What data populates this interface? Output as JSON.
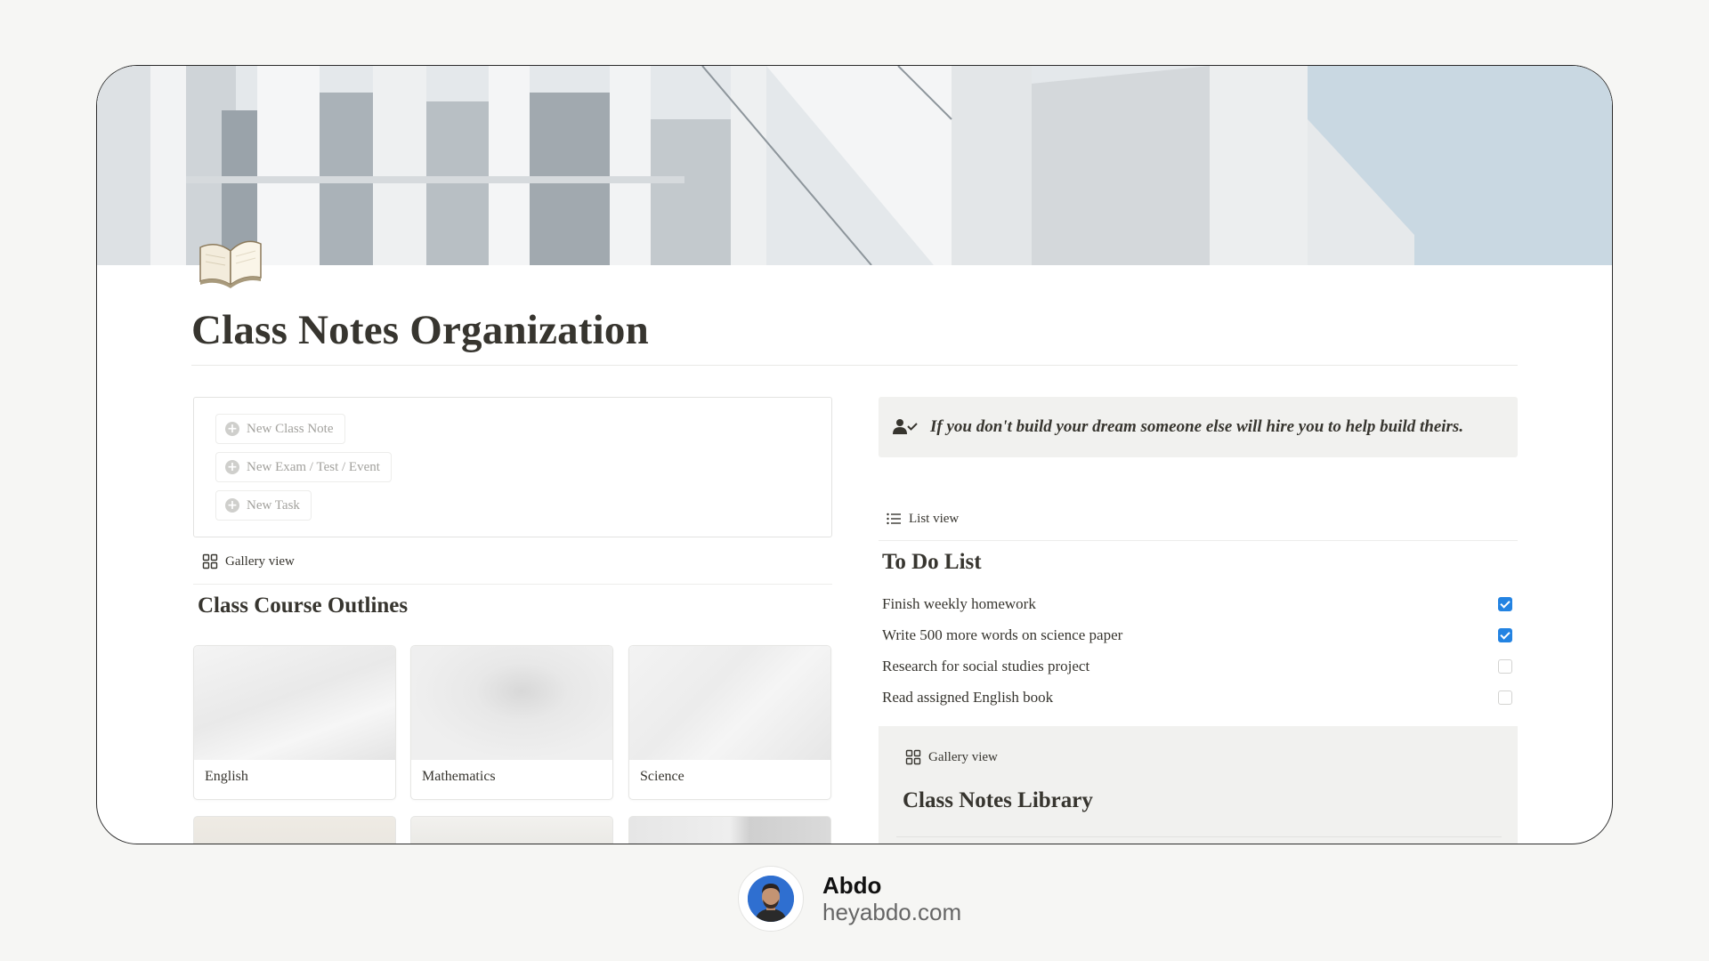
{
  "page": {
    "title": "Class Notes Organization",
    "icon": "open-book-icon"
  },
  "buttons": [
    {
      "label": "New Class Note",
      "icon": "plus-circle-icon"
    },
    {
      "label": "New Exam / Test / Event",
      "icon": "plus-circle-icon"
    },
    {
      "label": "New Task",
      "icon": "plus-circle-icon"
    }
  ],
  "course_outlines": {
    "view_label": "Gallery view",
    "view_icon": "gallery-icon",
    "heading": "Class Course Outlines",
    "cards": [
      {
        "name": "English"
      },
      {
        "name": "Mathematics"
      },
      {
        "name": "Science"
      }
    ]
  },
  "callout": {
    "icon": "person-check-icon",
    "quote": "If you don't build your dream someone else will hire you to help build theirs."
  },
  "todo": {
    "view_label": "List view",
    "view_icon": "list-icon",
    "heading": "To Do List",
    "items": [
      {
        "text": "Finish weekly homework",
        "checked": true
      },
      {
        "text": "Write 500 more words on science paper",
        "checked": true
      },
      {
        "text": "Research for social studies project",
        "checked": false
      },
      {
        "text": "Read assigned English book",
        "checked": false
      }
    ]
  },
  "library": {
    "view_label": "Gallery view",
    "view_icon": "gallery-icon",
    "heading": "Class Notes Library"
  },
  "author": {
    "name": "Abdo",
    "site": "heyabdo.com"
  },
  "colors": {
    "accent_checkbox": "#2383e2",
    "callout_bg": "#f1f1ef",
    "text": "#37352f"
  }
}
